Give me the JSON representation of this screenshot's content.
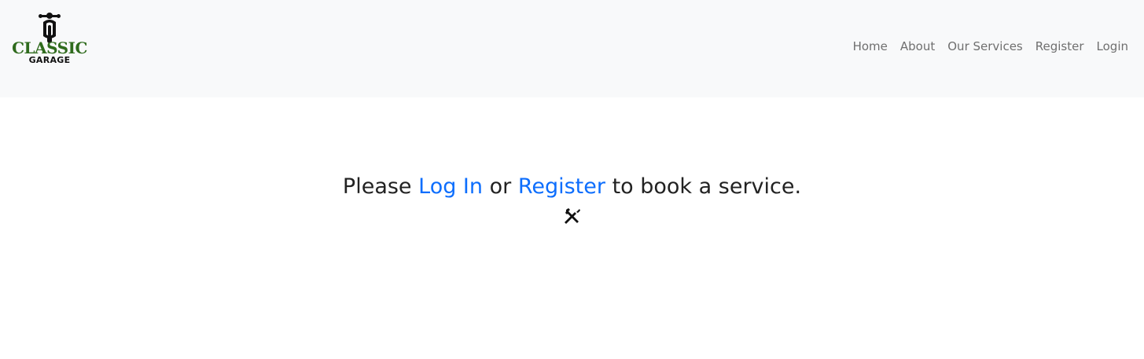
{
  "brand": {
    "line1": "CLASSIC",
    "line2": "GARAGE",
    "icon": "motorcycle-rider-icon",
    "color_primary": "#2f6b1d"
  },
  "nav": {
    "items": [
      {
        "label": "Home"
      },
      {
        "label": "About"
      },
      {
        "label": "Our Services"
      },
      {
        "label": "Register"
      },
      {
        "label": "Login"
      }
    ]
  },
  "main": {
    "prefix": "Please ",
    "login_link": "Log In",
    "middle": " or ",
    "register_link": "Register",
    "suffix": " to book a service.",
    "icon": "tools-icon",
    "link_color": "#0d6efd"
  }
}
